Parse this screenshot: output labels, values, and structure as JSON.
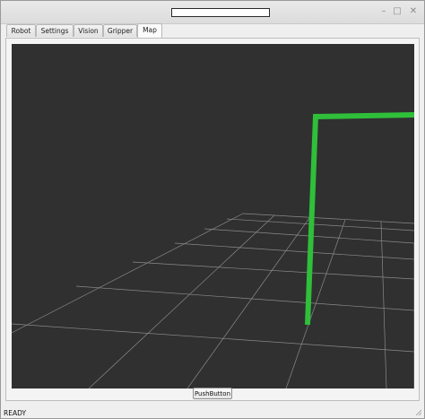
{
  "window": {
    "title_redacted": true,
    "controls": {
      "minimize_glyph": "–",
      "maximize_glyph": "□",
      "close_glyph": "✕"
    }
  },
  "tabs": [
    {
      "label": "Robot",
      "active": false
    },
    {
      "label": "Settings",
      "active": false
    },
    {
      "label": "Vision",
      "active": false
    },
    {
      "label": "Gripper",
      "active": false
    },
    {
      "label": "Map",
      "active": true
    }
  ],
  "viewport": {
    "background_color": "#303030",
    "grid_color": "#8a8a8a",
    "path_color": "#2fbf3a"
  },
  "push_button": {
    "label": "PushButton"
  },
  "status": {
    "text": "READY"
  }
}
